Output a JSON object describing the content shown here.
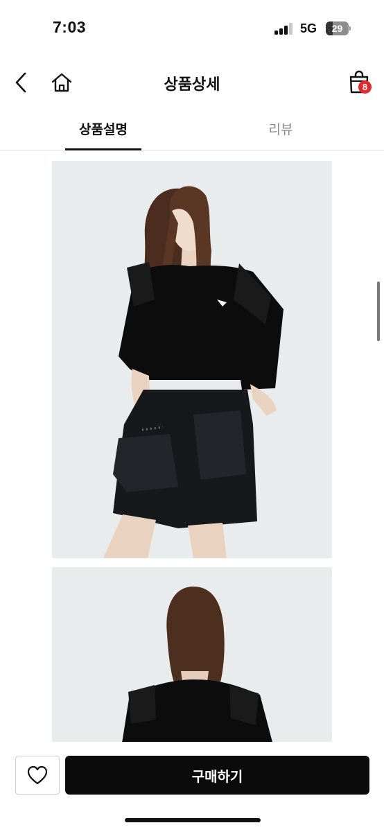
{
  "status_bar": {
    "time": "7:03",
    "network": "5G",
    "battery": "29",
    "battery_level": 0.29,
    "signal_bars_active": 3
  },
  "header": {
    "title": "상품상세",
    "back_icon": "chevron-left-icon",
    "home_icon": "home-icon",
    "cart_icon": "shopping-bag-icon",
    "cart_badge": "8",
    "badge_color": "#e0282d"
  },
  "tabs": [
    {
      "label": "상품설명",
      "active": true
    },
    {
      "label": "리뷰",
      "active": false
    }
  ],
  "content": {
    "images": [
      {
        "name": "product-photo-front"
      },
      {
        "name": "product-photo-back"
      }
    ]
  },
  "bottom_bar": {
    "wishlist_icon": "heart-icon",
    "buy_label": "구매하기",
    "buy_color": "#0b0b0b"
  }
}
